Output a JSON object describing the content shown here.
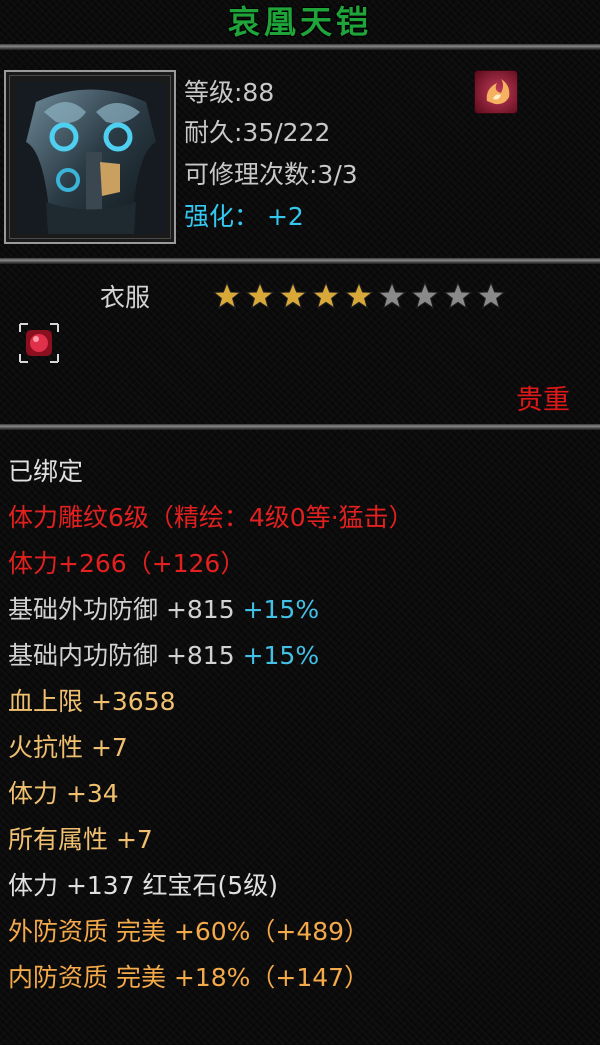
{
  "item": {
    "name": "哀凰天铠",
    "level": "等级:88",
    "durability": "耐久:35/222",
    "repairs": "可修理次数:3/3",
    "enhance_label": "强化：",
    "enhance_value": "+2",
    "type": "衣服",
    "stars_filled": 5,
    "stars_total": 9,
    "rarity": "贵重"
  },
  "stats": [
    {
      "parts": [
        {
          "text": "已绑定",
          "color": "white"
        }
      ]
    },
    {
      "parts": [
        {
          "text": "体力雕纹6级（精绘：4级0等·猛击）",
          "color": "red"
        }
      ]
    },
    {
      "parts": [
        {
          "text": "体力+266（+126）",
          "color": "red"
        }
      ]
    },
    {
      "parts": [
        {
          "text": "基础外功防御 +815 ",
          "color": "grey"
        },
        {
          "text": "+15%",
          "color": "cyan"
        }
      ]
    },
    {
      "parts": [
        {
          "text": "基础内功防御 +815 ",
          "color": "grey"
        },
        {
          "text": "+15%",
          "color": "cyan"
        }
      ]
    },
    {
      "parts": [
        {
          "text": "血上限 +3658",
          "color": "gold"
        }
      ]
    },
    {
      "parts": [
        {
          "text": "火抗性 +7",
          "color": "gold"
        }
      ]
    },
    {
      "parts": [
        {
          "text": "体力 +34",
          "color": "gold"
        }
      ]
    },
    {
      "parts": [
        {
          "text": "所有属性 +7",
          "color": "gold"
        }
      ]
    },
    {
      "parts": [
        {
          "text": "体力 +137 红宝石(5级)",
          "color": "white"
        }
      ]
    },
    {
      "parts": [
        {
          "text": "外防资质  完美 +60%（+489）",
          "color": "orange"
        }
      ]
    },
    {
      "parts": [
        {
          "text": "内防资质  完美 +18%（+147）",
          "color": "orange"
        }
      ]
    }
  ],
  "colors": {
    "title": "#1fa43a",
    "star_gold": "#d8a838",
    "star_grey": "#8a8a8a",
    "rarity": "#e01818"
  },
  "icons": {
    "item_image": "armor-icon",
    "skill": "fire-skill-icon",
    "gem": "ruby-gem-icon"
  }
}
